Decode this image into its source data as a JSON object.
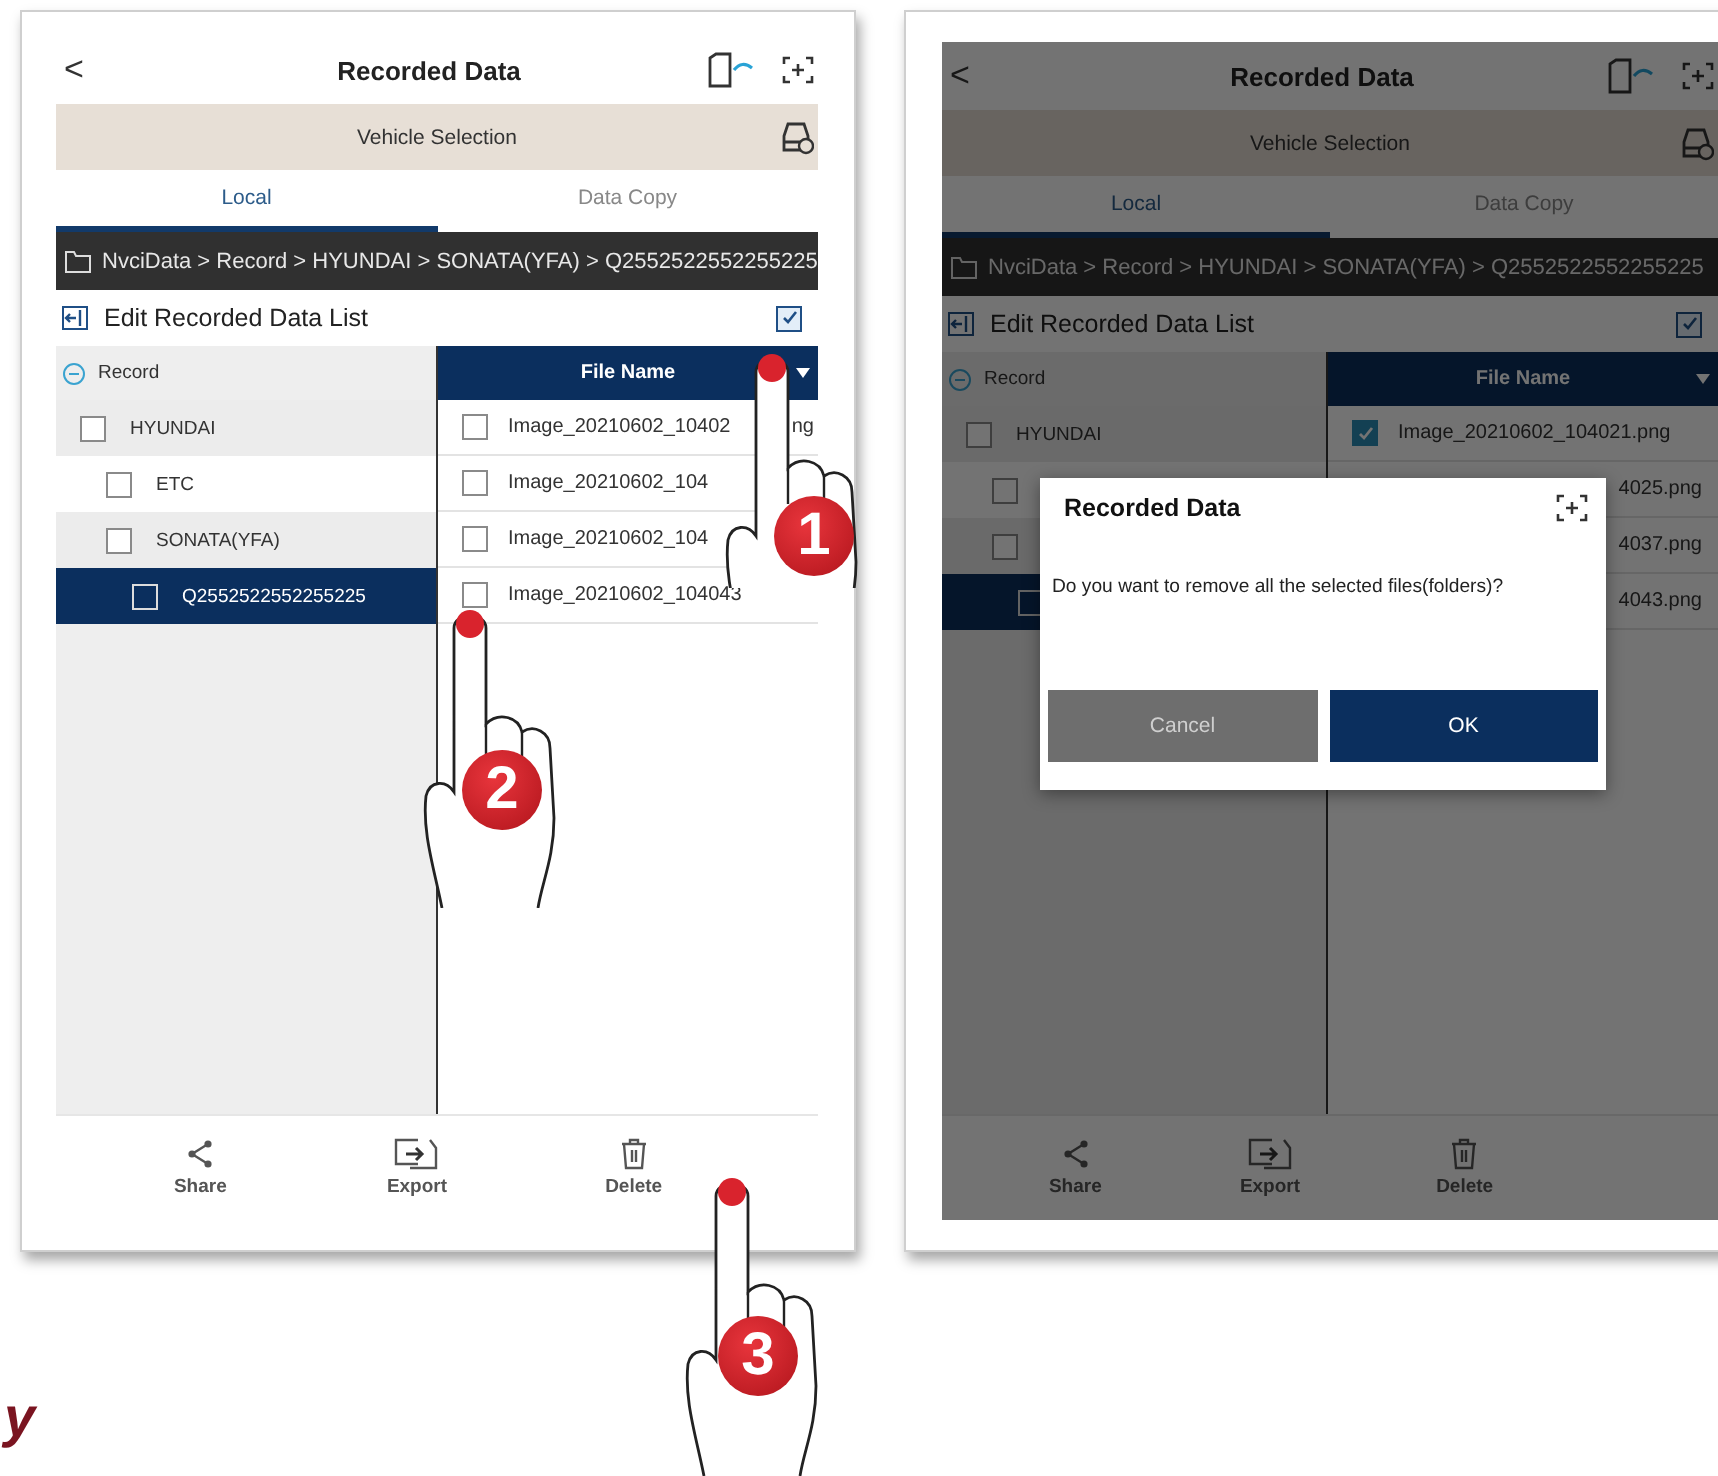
{
  "screens": [
    {
      "dimmed": false,
      "header": {
        "back": "<",
        "title": "Recorded Data"
      },
      "vehicle_bar": {
        "label": "Vehicle Selection"
      },
      "tabs": [
        {
          "label": "Local",
          "selected": true
        },
        {
          "label": "Data Copy",
          "selected": false
        }
      ],
      "path": "NvciData > Record > HYUNDAI > SONATA(YFA) > Q2552522552255225",
      "edit_bar": {
        "label": "Edit Recorded Data List",
        "select_all_checked": true
      },
      "tree": {
        "root": "Record",
        "expanded": true,
        "children": [
          {
            "label": "HYUNDAI",
            "checked": false,
            "selected": false,
            "children": [
              {
                "label": "ETC",
                "checked": false,
                "selected": false
              },
              {
                "label": "SONATA(YFA)",
                "checked": false,
                "selected": false,
                "children": [
                  {
                    "label": "Q2552522552255225",
                    "checked": false,
                    "selected": true
                  }
                ]
              }
            ]
          }
        ]
      },
      "file_list": {
        "header": "File Name",
        "files": [
          {
            "kind": "row",
            "name": "Image_20210602_10402",
            "tail": "ng",
            "checked": false
          },
          {
            "kind": "row",
            "name": "Image_20210602_104",
            "checked": false
          },
          {
            "kind": "row",
            "name": "Image_20210602_104",
            "checked": false
          },
          {
            "kind": "row",
            "name": "Image_20210602_104043",
            "checked": false
          }
        ]
      },
      "actions": [
        {
          "kind": "share",
          "label": "Share"
        },
        {
          "kind": "export",
          "label": "Export"
        },
        {
          "kind": "delete",
          "label": "Delete"
        }
      ]
    },
    {
      "dimmed": true,
      "header": {
        "back": "<",
        "title": "Recorded Data"
      },
      "vehicle_bar": {
        "label": "Vehicle Selection"
      },
      "tabs": [
        {
          "label": "Local",
          "selected": true
        },
        {
          "label": "Data Copy",
          "selected": false
        }
      ],
      "path": "NvciData > Record > HYUNDAI > SONATA(YFA) > Q2552522552255225",
      "edit_bar": {
        "label": "Edit Recorded Data List",
        "select_all_checked": true
      },
      "tree": {
        "root": "Record",
        "expanded": true,
        "children": [
          {
            "label": "HYUNDAI",
            "checked": false,
            "selected": false,
            "children": [
              {
                "checked": false,
                "selected": false
              },
              {
                "checked": false,
                "selected": false,
                "children": [
                  {
                    "checked": false,
                    "selected": true
                  }
                ]
              }
            ]
          }
        ]
      },
      "file_list": {
        "header": "File Name",
        "files": [
          {
            "kind": "row",
            "name": "Image_20210602_104021.png",
            "checked": true
          },
          {
            "kind": "fragment",
            "name": "4025.png"
          },
          {
            "kind": "fragment",
            "name": "4037.png"
          },
          {
            "kind": "fragment",
            "name": "4043.png"
          }
        ]
      },
      "actions": [
        {
          "kind": "share",
          "label": "Share"
        },
        {
          "kind": "export",
          "label": "Export"
        },
        {
          "kind": "delete",
          "label": "Delete"
        }
      ],
      "dialog": {
        "title": "Recorded Data",
        "message": "Do you want to remove all the selected files(folders)?",
        "buttons": [
          {
            "kind": "secondary",
            "label": "Cancel"
          },
          {
            "kind": "primary",
            "label": "OK"
          }
        ]
      }
    }
  ],
  "callouts": [
    {
      "number": "1"
    },
    {
      "number": "2"
    },
    {
      "number": "3"
    }
  ],
  "margin_fragment": "y"
}
